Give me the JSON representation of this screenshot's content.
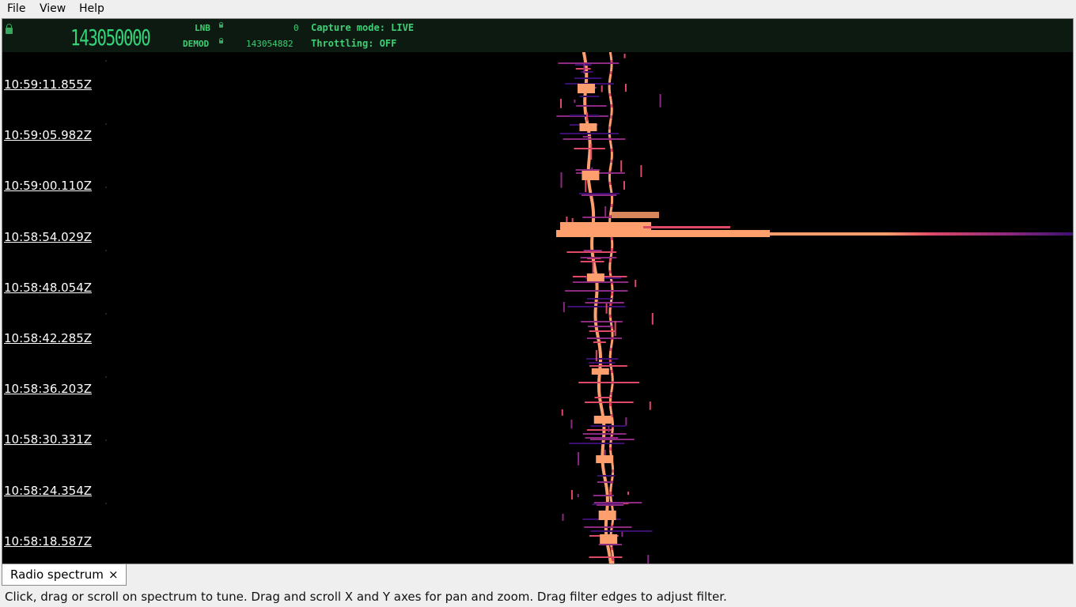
{
  "menu": {
    "file": "File",
    "view": "View",
    "help": "Help"
  },
  "header": {
    "main_frequency": "143050000",
    "lnb_label": "LNB",
    "lnb_value": "0",
    "demod_label": "DEMOD",
    "demod_value": "143054882",
    "capture_mode": "Capture mode: LIVE",
    "throttling": "Throttling: OFF"
  },
  "waterfall": {
    "colormap": [
      "#000000",
      "#3b0f70",
      "#8c2981",
      "#de4968",
      "#fe9f6d",
      "#fcfdbf"
    ],
    "timestamps": [
      "10:59:11.855Z",
      "10:59:05.982Z",
      "10:59:00.110Z",
      "10:58:54.029Z",
      "10:58:48.054Z",
      "10:58:42.285Z",
      "10:58:36.203Z",
      "10:58:30.331Z",
      "10:58:24.354Z",
      "10:58:18.587Z"
    ]
  },
  "tabs": [
    {
      "label": "Radio spectrum",
      "close": "×"
    }
  ],
  "statusbar": {
    "text": "Click, drag or scroll on spectrum to tune. Drag and scroll X and Y axes for pan and zoom. Drag filter edges to adjust filter."
  }
}
